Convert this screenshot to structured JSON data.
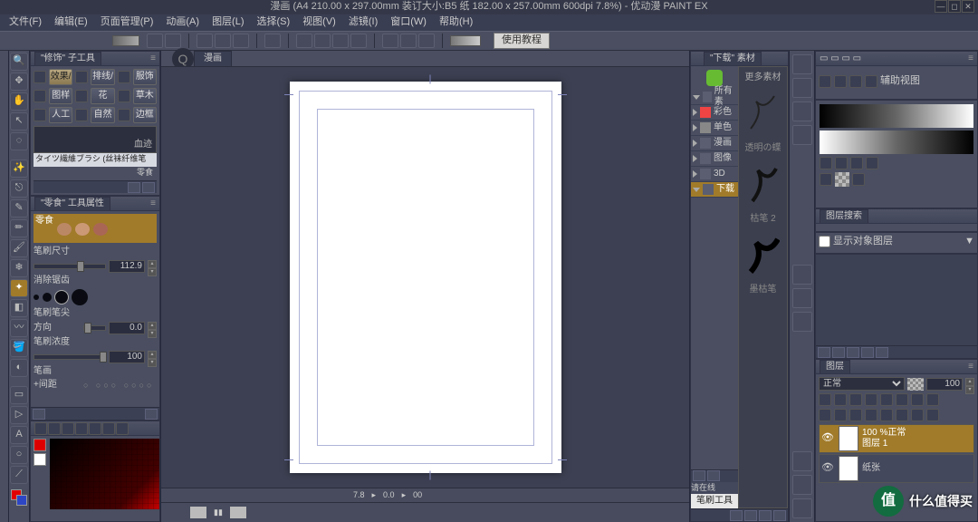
{
  "title": "漫画 (A4 210.00 x 297.00mm 装订大小:B5 纸 182.00 x 257.00mm 600dpi 7.8%)  - 优动漫 PAINT EX",
  "menu": [
    "文件(F)",
    "编辑(E)",
    "页面管理(P)",
    "动画(A)",
    "图层(L)",
    "选择(S)",
    "视图(V)",
    "滤镜(I)",
    "窗口(W)",
    "帮助(H)"
  ],
  "toolbar": {
    "tutorial": "使用教程"
  },
  "canvas": {
    "tab": "漫画",
    "zoom": "7.8",
    "rot_deg": "0.0",
    "rot_min": "00"
  },
  "subtool": {
    "header": "\"修饰\" 子工具",
    "rows": [
      [
        "效果/",
        "排线/",
        "服饰"
      ],
      [
        "图样",
        "花",
        "草木"
      ],
      [
        "人工",
        "自然",
        "边框"
      ]
    ],
    "cloud_label": "血迹",
    "fiber_label": "タイツ繊維ブラシ (丝袜纤维笔",
    "snack_label": "零食"
  },
  "toolprop": {
    "header": "\"零食\" 工具属性",
    "preset": "零食",
    "size_label": "笔刷尺寸",
    "size_val": "112.9",
    "aa_label": "消除锯齿",
    "tip_label": "笔刷笔尖",
    "dir_label": "方向",
    "dir_val": "0.0",
    "density_label": "笔刷浓度",
    "density_val": "100",
    "spacing_label": "笔画",
    "spacing2": "+间距"
  },
  "material": {
    "header": "\"下载\" 素材",
    "more": "更多素材",
    "tree": [
      {
        "expand": "down",
        "icon": "",
        "label": "所有素"
      },
      {
        "expand": "right",
        "icon": "X",
        "label": "彩色"
      },
      {
        "expand": "right",
        "icon": "X",
        "label": "单色"
      },
      {
        "expand": "right",
        "icon": "",
        "label": "漫画"
      },
      {
        "expand": "right",
        "icon": "",
        "label": "图像"
      },
      {
        "expand": "right",
        "icon": "",
        "label": "3D"
      },
      {
        "expand": "down",
        "icon": "",
        "label": "下载",
        "sel": true
      }
    ],
    "now_label": "请在线",
    "brush_tool": "笔刷工具",
    "brushes": [
      "透明の蝶",
      "枯笔 2",
      "墨枯笔"
    ]
  },
  "right": {
    "aux": "辅助视图",
    "search": "图层搜索",
    "display": "显示对象图层",
    "layer_tab": "图层",
    "blend": "正常",
    "opacity": "100",
    "layers": [
      {
        "name": "100 %正常",
        "sub": "图层 1"
      },
      {
        "name": "",
        "sub": "纸张"
      }
    ]
  },
  "colors": {
    "fg": "#d00",
    "bg": "#ffffff",
    "tool_c1": "#e20000",
    "tool_c2": "#2d46c4"
  },
  "watermark": {
    "icon": "值",
    "text": "什么值得买"
  }
}
